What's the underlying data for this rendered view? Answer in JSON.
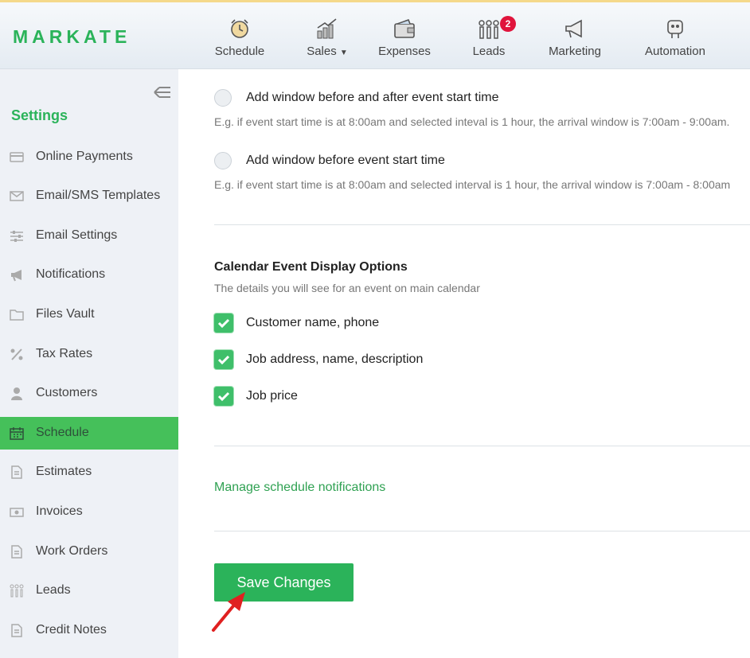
{
  "brand": {
    "name": "MARKATE",
    "accent": "#2bb35a"
  },
  "nav": [
    {
      "label": "Schedule",
      "icon": "alarm-clock-icon"
    },
    {
      "label": "Sales",
      "icon": "bar-chart-coins-icon",
      "dropdown": true
    },
    {
      "label": "Expenses",
      "icon": "wallet-icon"
    },
    {
      "label": "Leads",
      "icon": "people-icon",
      "badge": "2"
    },
    {
      "label": "Marketing",
      "icon": "megaphone-icon"
    },
    {
      "label": "Automation",
      "icon": "robot-icon"
    }
  ],
  "sidebar": {
    "title": "Settings",
    "items": [
      {
        "label": "Online Payments",
        "icon": "credit-card-icon"
      },
      {
        "label": "Email/SMS Templates",
        "icon": "envelope-icon"
      },
      {
        "label": "Email Settings",
        "icon": "sliders-icon"
      },
      {
        "label": "Notifications",
        "icon": "bullhorn-icon"
      },
      {
        "label": "Files Vault",
        "icon": "folder-icon"
      },
      {
        "label": "Tax Rates",
        "icon": "percent-icon"
      },
      {
        "label": "Customers",
        "icon": "user-icon"
      },
      {
        "label": "Schedule",
        "icon": "calendar-icon",
        "active": true
      },
      {
        "label": "Estimates",
        "icon": "document-icon"
      },
      {
        "label": "Invoices",
        "icon": "money-icon"
      },
      {
        "label": "Work Orders",
        "icon": "document-icon"
      },
      {
        "label": "Leads",
        "icon": "people-icon"
      },
      {
        "label": "Credit Notes",
        "icon": "document-icon"
      }
    ]
  },
  "arrival": {
    "option1_label": "Add window before and after event start time",
    "option1_hint": "E.g. if event start time is at 8:00am and selected inteval is 1 hour, the arrival window is 7:00am - 9:00am.",
    "option2_label": "Add window before event start time",
    "option2_hint": "E.g. if event start time is at 8:00am and selected interval is 1 hour, the arrival window is 7:00am - 8:00am"
  },
  "display_options": {
    "title": "Calendar Event Display Options",
    "subtitle": "The details you will see for an event on main calendar",
    "items": [
      {
        "label": "Customer name, phone",
        "checked": true
      },
      {
        "label": "Job address, name, description",
        "checked": true
      },
      {
        "label": "Job price",
        "checked": true
      }
    ]
  },
  "manage_link": "Manage schedule notifications",
  "save_label": "Save Changes"
}
